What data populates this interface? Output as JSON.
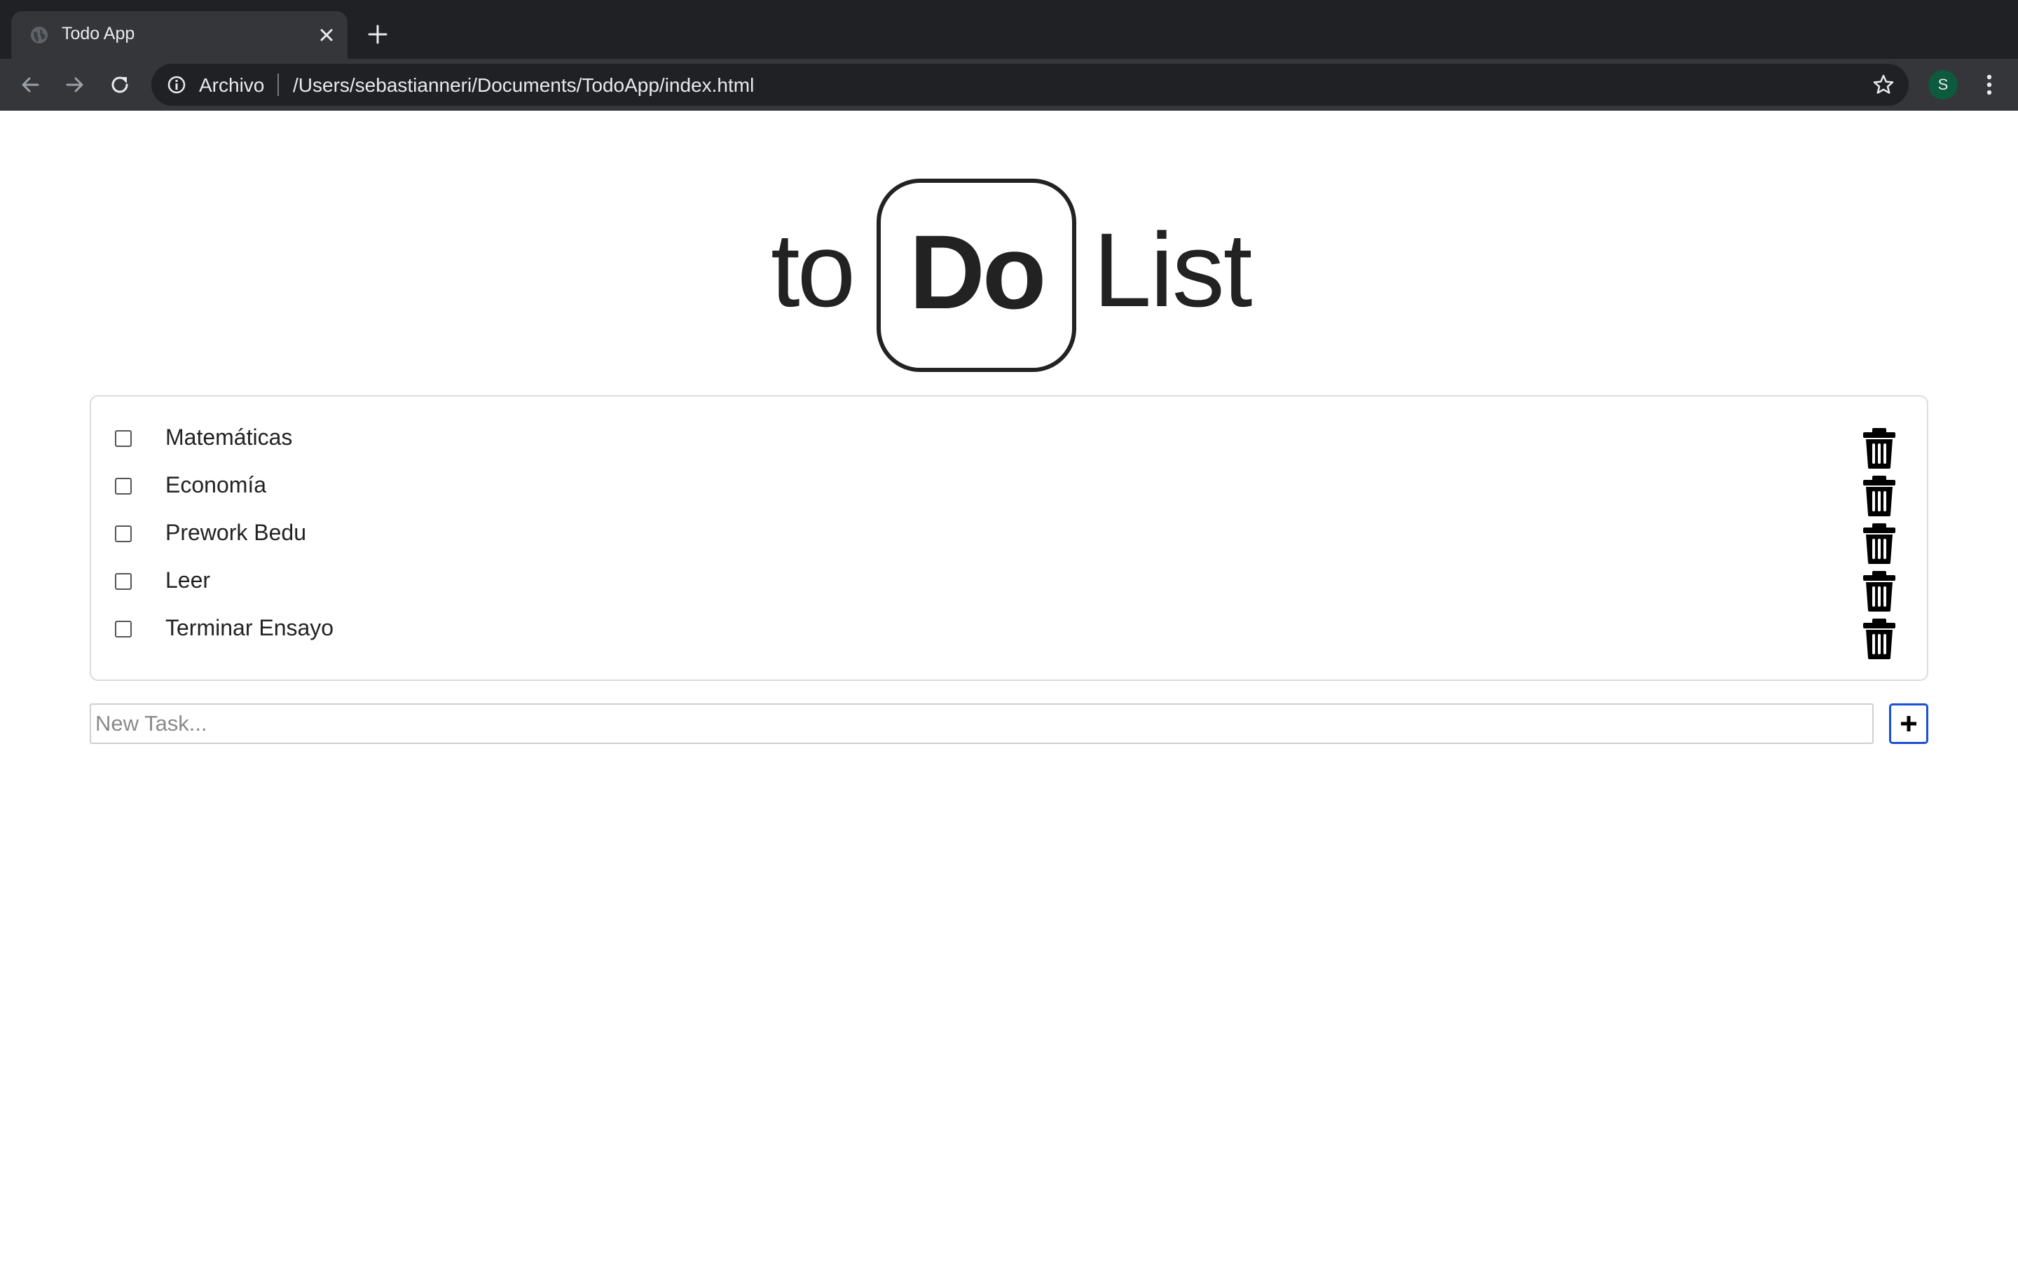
{
  "browser": {
    "tab_title": "Todo App",
    "address_scheme_label": "Archivo",
    "address_url": "/Users/sebastianneri/Documents/TodoApp/index.html",
    "profile_initial": "S",
    "profile_color": "#0d5a3f",
    "icons": [
      "globe-icon",
      "close-icon",
      "plus-icon",
      "back-arrow-icon",
      "forward-arrow-icon",
      "reload-icon",
      "info-icon",
      "star-icon",
      "kebab-menu-icon"
    ]
  },
  "logo": {
    "part_to": "to",
    "part_do": "Do",
    "part_list": "List"
  },
  "tasks": [
    {
      "label": "Matemáticas",
      "checked": false
    },
    {
      "label": "Economía",
      "checked": false
    },
    {
      "label": "Prework Bedu",
      "checked": false
    },
    {
      "label": "Leer",
      "checked": false
    },
    {
      "label": "Terminar Ensayo",
      "checked": false
    }
  ],
  "new_task": {
    "placeholder": "New Task...",
    "value": ""
  },
  "colors": {
    "add_button_border": "#1a4fd6",
    "chrome_dark": "#202124",
    "chrome_toolbar": "#35363a"
  }
}
